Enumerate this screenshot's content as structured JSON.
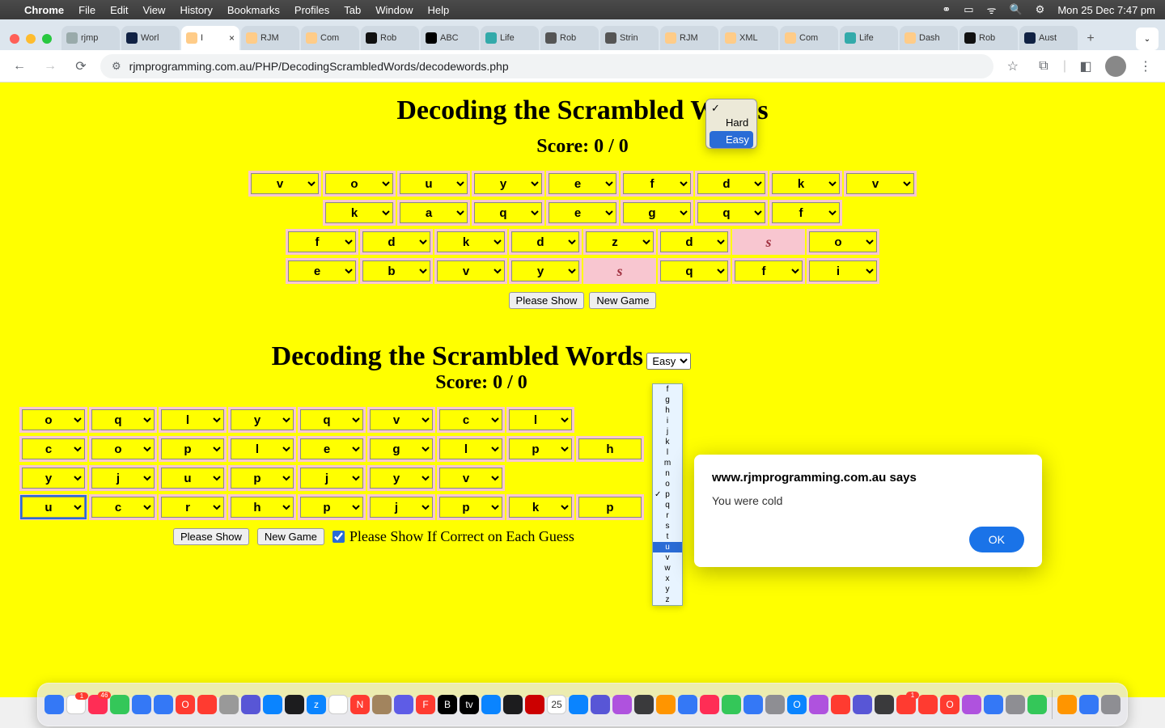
{
  "menubar": {
    "app": "Chrome",
    "items": [
      "File",
      "Edit",
      "View",
      "History",
      "Bookmarks",
      "Profiles",
      "Tab",
      "Window",
      "Help"
    ],
    "clock": "Mon 25 Dec  7:47 pm"
  },
  "tabs": [
    {
      "label": "rjmp",
      "fav": "#9aa"
    },
    {
      "label": "Worl",
      "fav": "#124"
    },
    {
      "label": "I",
      "fav": "#fc8",
      "active": true,
      "closable": true
    },
    {
      "label": "RJM",
      "fav": "#fc8"
    },
    {
      "label": "Com",
      "fav": "#fc8"
    },
    {
      "label": "Rob",
      "fav": "#111"
    },
    {
      "label": "ABC",
      "fav": "#000"
    },
    {
      "label": "Life",
      "fav": "#3aa"
    },
    {
      "label": "Rob",
      "fav": "#555"
    },
    {
      "label": "Strin",
      "fav": "#555"
    },
    {
      "label": "RJM",
      "fav": "#fc8"
    },
    {
      "label": "XML",
      "fav": "#fc8"
    },
    {
      "label": "Com",
      "fav": "#fc8"
    },
    {
      "label": "Life",
      "fav": "#3aa"
    },
    {
      "label": "Dash",
      "fav": "#fc8"
    },
    {
      "label": "Rob",
      "fav": "#111"
    },
    {
      "label": "Aust",
      "fav": "#124"
    }
  ],
  "url": "rjmprogramming.com.au/PHP/DecodingScrambledWords/decodewords.php",
  "game1": {
    "title": "Decoding the Scrambled Words",
    "score": "Score: 0 / 0",
    "difficulty_menu": {
      "options": [
        "",
        "Hard",
        "Easy"
      ],
      "checked_index": 0,
      "highlight_index": 2
    },
    "rows": [
      [
        {
          "v": "v"
        },
        {
          "v": "o"
        },
        {
          "v": "u"
        },
        {
          "v": "y"
        },
        {
          "v": "e"
        },
        {
          "v": "f"
        },
        {
          "v": "d"
        },
        {
          "v": "k"
        },
        {
          "v": "v"
        }
      ],
      [
        {
          "v": "k"
        },
        {
          "v": "a"
        },
        {
          "v": "q"
        },
        {
          "v": "e"
        },
        {
          "v": "g"
        },
        {
          "v": "q"
        },
        {
          "v": "f"
        }
      ],
      [
        {
          "v": "f"
        },
        {
          "v": "d"
        },
        {
          "v": "k"
        },
        {
          "v": "d"
        },
        {
          "v": "z"
        },
        {
          "v": "d"
        },
        {
          "v": "s",
          "correct": true
        },
        {
          "v": "o"
        }
      ],
      [
        {
          "v": "e"
        },
        {
          "v": "b"
        },
        {
          "v": "v"
        },
        {
          "v": "y"
        },
        {
          "v": "s",
          "correct": true
        },
        {
          "v": "q"
        },
        {
          "v": "f"
        },
        {
          "v": "i"
        }
      ]
    ],
    "btn_show": "Please Show",
    "btn_new": "New Game"
  },
  "game2": {
    "title": "Decoding the Scrambled Words",
    "difficulty_current": "Easy",
    "score": "Score: 0 / 0",
    "rows": [
      [
        {
          "v": "o"
        },
        {
          "v": "q"
        },
        {
          "v": "l"
        },
        {
          "v": "y"
        },
        {
          "v": "q"
        },
        {
          "v": "v"
        },
        {
          "v": "c"
        },
        {
          "v": "l"
        }
      ],
      [
        {
          "v": "c"
        },
        {
          "v": "o"
        },
        {
          "v": "p"
        },
        {
          "v": "l"
        },
        {
          "v": "e"
        },
        {
          "v": "g"
        },
        {
          "v": "l"
        },
        {
          "v": "p"
        },
        {
          "v": "h",
          "text": true
        }
      ],
      [
        {
          "v": "y"
        },
        {
          "v": "j"
        },
        {
          "v": "u"
        },
        {
          "v": "p"
        },
        {
          "v": "j"
        },
        {
          "v": "y"
        },
        {
          "v": "v"
        }
      ],
      [
        {
          "v": "u",
          "focus": true
        },
        {
          "v": "c"
        },
        {
          "v": "r"
        },
        {
          "v": "h"
        },
        {
          "v": "p"
        },
        {
          "v": "j"
        },
        {
          "v": "p"
        },
        {
          "v": "k"
        },
        {
          "v": "p",
          "text": true
        }
      ]
    ],
    "btn_show": "Please Show",
    "btn_new": "New Game",
    "checkbox_label": "Please Show If Correct on Each Guess",
    "checkbox_checked": true
  },
  "letterlist": {
    "letters": [
      "f",
      "g",
      "h",
      "i",
      "j",
      "k",
      "l",
      "m",
      "n",
      "o",
      "p",
      "q",
      "r",
      "s",
      "t",
      "u",
      "v",
      "w",
      "x",
      "y",
      "z"
    ],
    "checked": "p",
    "selected": "u"
  },
  "alert": {
    "title": "www.rjmprogramming.com.au says",
    "message": "You were cold",
    "ok": "OK"
  },
  "dock": {
    "icons": [
      {
        "c": "#3478f6",
        "t": ""
      },
      {
        "c": "#fff",
        "t": "",
        "badge": "1"
      },
      {
        "c": "#ff2d55",
        "t": "",
        "badge": "46"
      },
      {
        "c": "#34c759",
        "t": ""
      },
      {
        "c": "#3478f6",
        "t": ""
      },
      {
        "c": "#3478f6",
        "t": ""
      },
      {
        "c": "#ff3b30",
        "t": "O"
      },
      {
        "c": "#ff3b30",
        "t": ""
      },
      {
        "c": "#999",
        "t": ""
      },
      {
        "c": "#5856d6",
        "t": ""
      },
      {
        "c": "#0a84ff",
        "t": ""
      },
      {
        "c": "#1c1c1e",
        "t": ""
      },
      {
        "c": "#0a84ff",
        "t": "z"
      },
      {
        "c": "#fff",
        "t": ""
      },
      {
        "c": "#ff3b30",
        "t": "N"
      },
      {
        "c": "#a2845e",
        "t": ""
      },
      {
        "c": "#5e5ce6",
        "t": ""
      },
      {
        "c": "#ff3b30",
        "t": "F"
      },
      {
        "c": "#000",
        "t": "B"
      },
      {
        "c": "#000",
        "t": "tv"
      },
      {
        "c": "#0a84ff",
        "t": ""
      },
      {
        "c": "#1c1c1e",
        "t": ""
      },
      {
        "c": "#c00",
        "t": ""
      },
      {
        "c": "#fff",
        "t": "25"
      },
      {
        "c": "#0a84ff",
        "t": ""
      },
      {
        "c": "#5856d6",
        "t": ""
      },
      {
        "c": "#af52de",
        "t": ""
      },
      {
        "c": "#3a3a3c",
        "t": ""
      },
      {
        "c": "#ff9500",
        "t": ""
      },
      {
        "c": "#3478f6",
        "t": ""
      },
      {
        "c": "#ff2d55",
        "t": ""
      },
      {
        "c": "#34c759",
        "t": ""
      },
      {
        "c": "#3478f6",
        "t": ""
      },
      {
        "c": "#8e8e93",
        "t": ""
      },
      {
        "c": "#0a84ff",
        "t": "O"
      },
      {
        "c": "#af52de",
        "t": ""
      },
      {
        "c": "#ff3b30",
        "t": ""
      },
      {
        "c": "#5856d6",
        "t": ""
      },
      {
        "c": "#3a3a3c",
        "t": ""
      },
      {
        "c": "#ff3b30",
        "t": "",
        "badge": "1"
      },
      {
        "c": "#ff3b30",
        "t": ""
      },
      {
        "c": "#ff3b30",
        "t": "O"
      },
      {
        "c": "#af52de",
        "t": ""
      },
      {
        "c": "#3478f6",
        "t": ""
      },
      {
        "c": "#8e8e93",
        "t": ""
      },
      {
        "c": "#34c759",
        "t": ""
      },
      {
        "c": "#ff9500",
        "t": ""
      },
      {
        "c": "#3478f6",
        "t": ""
      },
      {
        "c": "#8e8e93",
        "t": ""
      }
    ]
  }
}
